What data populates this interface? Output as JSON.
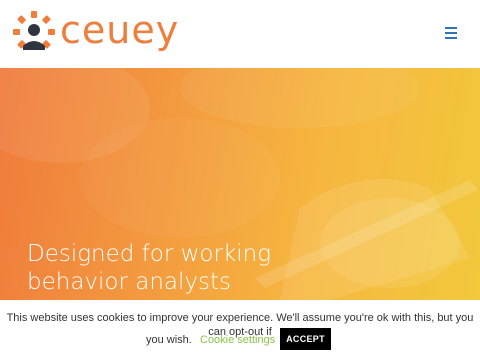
{
  "header": {
    "logo_text": "ceuey",
    "logo_icon": "ceuey-logo-icon",
    "menu_icon": "hamburger-menu-icon"
  },
  "hero": {
    "title": "Designed for working\nbehavior analysts"
  },
  "cookie_notice": {
    "message": "This website uses cookies to improve your experience. We'll assume you're ok with this, but you can opt-out if",
    "message_end": "you wish.",
    "settings_label": "Cookie settings",
    "accept_label": "ACCEPT"
  },
  "colors": {
    "brand_orange": "#ef7d3c",
    "menu_blue": "#2e73b8",
    "cookie_settings_green": "#8bc34a",
    "accept_button_bg": "#000000"
  }
}
